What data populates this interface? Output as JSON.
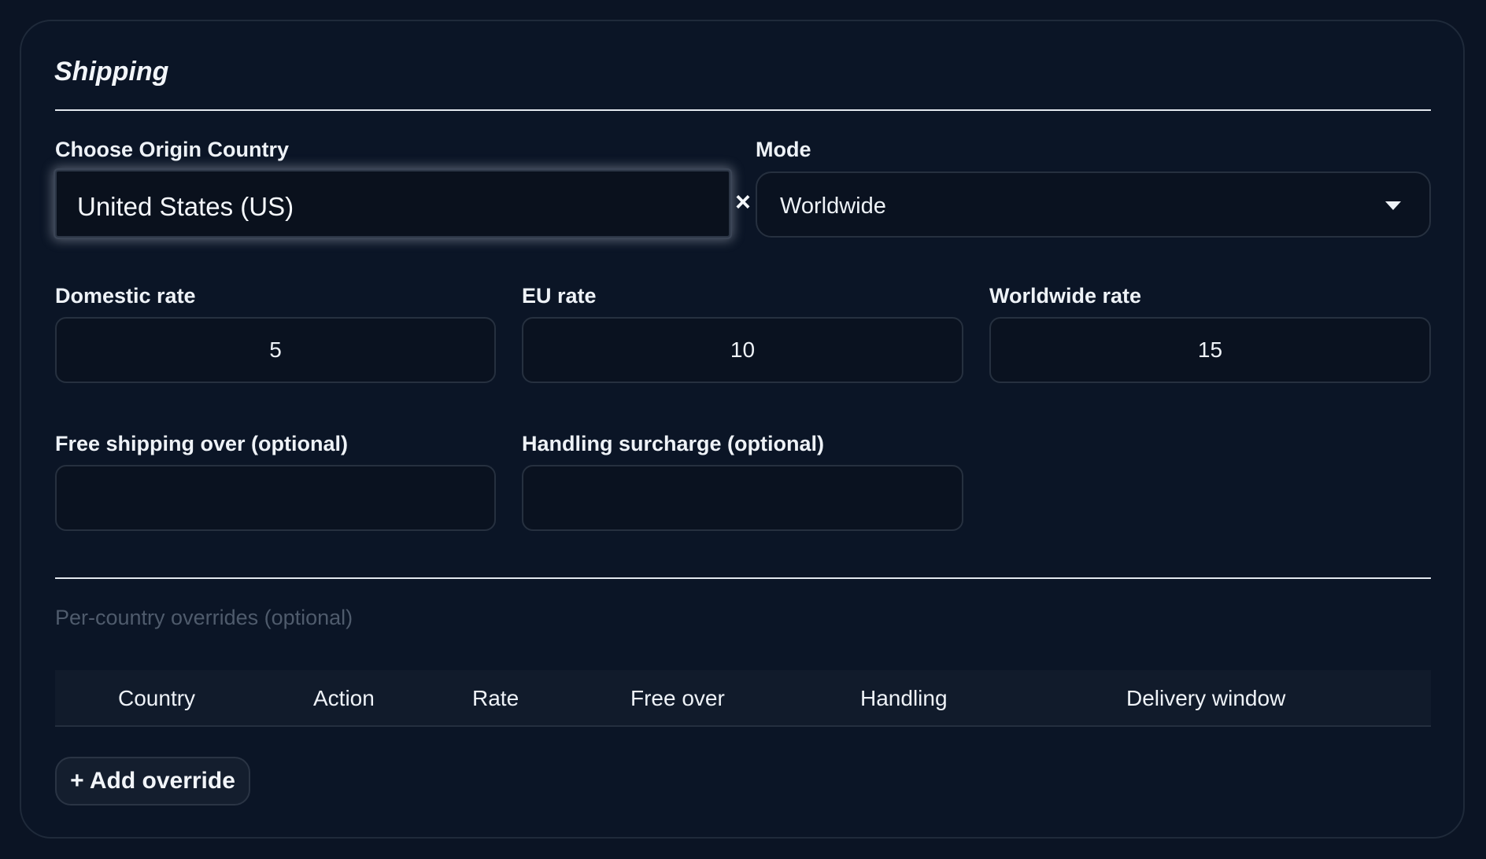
{
  "shipping": {
    "title": "Shipping",
    "origin": {
      "label": "Choose Origin Country",
      "value": "United States (US)",
      "clear_symbol": "×"
    },
    "mode": {
      "label": "Mode",
      "value": "Worldwide"
    },
    "rates": {
      "domestic": {
        "label": "Domestic rate",
        "value": "5"
      },
      "eu": {
        "label": "EU rate",
        "value": "10"
      },
      "worldwide": {
        "label": "Worldwide rate",
        "value": "15"
      }
    },
    "optional": {
      "free_shipping": {
        "label": "Free shipping over (optional)",
        "value": ""
      },
      "handling": {
        "label": "Handling surcharge (optional)",
        "value": ""
      }
    },
    "overrides": {
      "heading": "Per-country overrides (optional)",
      "columns": [
        "Country",
        "Action",
        "Rate",
        "Free over",
        "Handling",
        "Delivery window"
      ],
      "add_button": "+ Add override"
    }
  },
  "colors": {
    "background": "#0b1424",
    "panel": "#0b1526",
    "text": "#eef2f7",
    "muted": "#4f5b6c",
    "border": "#26303f"
  }
}
